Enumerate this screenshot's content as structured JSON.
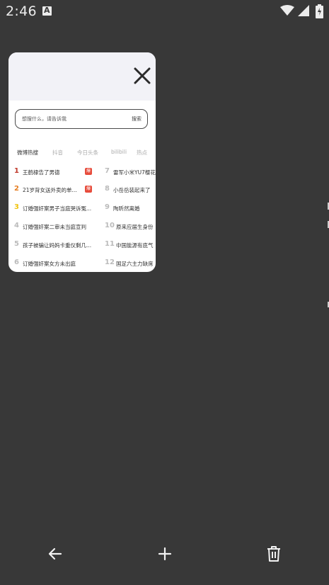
{
  "status_bar": {
    "time": "2:46",
    "notification_icon": "a-badge-icon",
    "icons": [
      "wifi-icon",
      "signal-icon",
      "battery-icon"
    ]
  },
  "tab_card": {
    "close_icon": "close-icon",
    "search": {
      "placeholder": "想搜什么，请告诉我",
      "button_label": "搜索"
    },
    "hot_tabs": [
      {
        "label": "微博热搜",
        "active": true
      },
      {
        "label": "抖音",
        "active": false
      },
      {
        "label": "今日头条",
        "active": false
      },
      {
        "label": "bilibili",
        "active": false
      },
      {
        "label": "热点",
        "active": false
      }
    ],
    "hot_items_left": [
      {
        "rank": "1",
        "title": "王鹤棣告了男德",
        "badge": "爆"
      },
      {
        "rank": "2",
        "title": "21岁背女送外卖的单...",
        "badge": "爆"
      },
      {
        "rank": "3",
        "title": "订婚强奸案男子当庭哭诉冤...",
        "badge": ""
      },
      {
        "rank": "4",
        "title": "订婚强奸案二审未当庭宣判",
        "badge": ""
      },
      {
        "rank": "5",
        "title": "孩子被骗让妈妈卡重仪剩几...",
        "badge": ""
      },
      {
        "rank": "6",
        "title": "订婚强奸案女方未出庭",
        "badge": ""
      }
    ],
    "hot_items_right": [
      {
        "rank": "7",
        "title": "雷军小米YU7樱花"
      },
      {
        "rank": "8",
        "title": "小岳岳装起来了"
      },
      {
        "rank": "9",
        "title": "陶昕然离婚"
      },
      {
        "rank": "10",
        "title": "原来应届生身份"
      },
      {
        "rank": "11",
        "title": "中国能源有底气"
      },
      {
        "rank": "12",
        "title": "国足六主力缺席"
      }
    ]
  },
  "bottom_bar": {
    "back_icon": "arrow-left-icon",
    "new_tab_icon": "plus-icon",
    "delete_icon": "trash-icon"
  },
  "colors": {
    "background": "#383838",
    "card": "#ffffff",
    "card_header": "#f2f2f7",
    "rank_1": "#c0392b",
    "rank_2": "#e67e22",
    "rank_3": "#f1c40f",
    "badge": "#e74c3c"
  }
}
